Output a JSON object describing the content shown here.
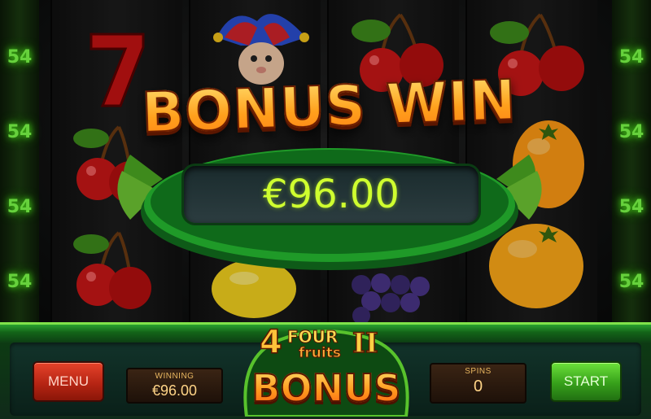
{
  "game": {
    "payline_left": [
      "54",
      "54",
      "54",
      "54"
    ],
    "payline_right": [
      "54",
      "54",
      "54",
      "54"
    ],
    "reel_symbols": [
      [
        "seven",
        "cherry",
        "cherry"
      ],
      [
        "jester",
        "lemon"
      ],
      [
        "cherry",
        "grapes"
      ],
      [
        "cherry",
        "orange",
        "orange"
      ]
    ],
    "colors": {
      "payline_glow": "#7dff4a",
      "amount_text": "#cfff2f",
      "bonus_title": "#ffa01c",
      "menu_button": "#c22d18",
      "start_button": "#3fae20"
    }
  },
  "bonus_popup": {
    "title": "BONUS WIN",
    "amount": "€96.00"
  },
  "logo": {
    "number": "4",
    "word_four": "FOUR",
    "word_fruits": "fruits",
    "roman": "II",
    "word_bonus": "BONUS"
  },
  "controls": {
    "menu_label": "MENU",
    "winning_label": "WINNING",
    "winning_value": "€96.00",
    "spins_label": "SPINS",
    "spins_value": "0",
    "start_label": "START"
  }
}
